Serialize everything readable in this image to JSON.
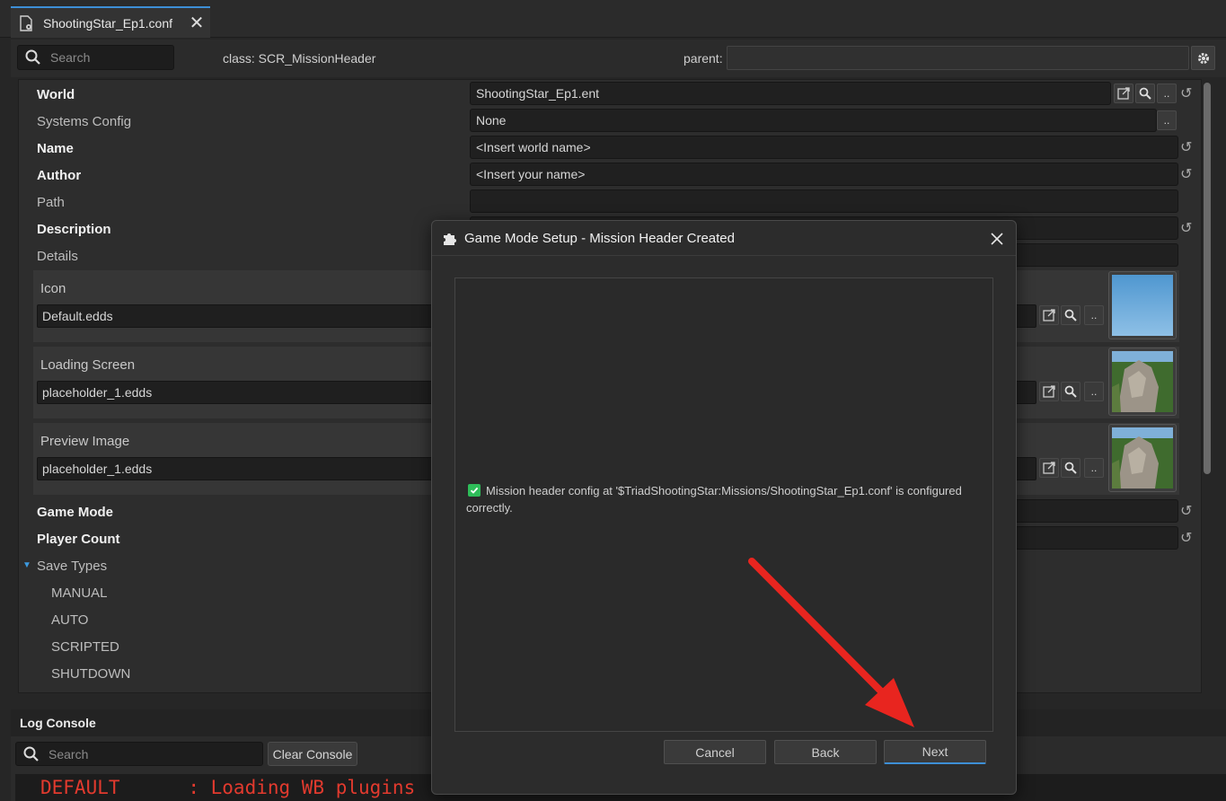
{
  "tab": {
    "title": "ShootingStar_Ep1.conf"
  },
  "header": {
    "search_placeholder": "Search",
    "class_label": "class: SCR_MissionHeader",
    "parent_label": "parent:"
  },
  "properties": {
    "world": {
      "label": "World",
      "value": "ShootingStar_Ep1.ent"
    },
    "systems_config": {
      "label": "Systems Config",
      "value": "None"
    },
    "name": {
      "label": "Name",
      "value": "<Insert world name>"
    },
    "author": {
      "label": "Author",
      "value": "<Insert your name>"
    },
    "path": {
      "label": "Path",
      "value": ""
    },
    "description": {
      "label": "Description"
    },
    "details": {
      "label": "Details"
    },
    "icon": {
      "label": "Icon",
      "value": "Default.edds"
    },
    "loading_screen": {
      "label": "Loading Screen",
      "value": "placeholder_1.edds"
    },
    "preview_image": {
      "label": "Preview Image",
      "value": "placeholder_1.edds"
    },
    "game_mode": {
      "label": "Game Mode"
    },
    "player_count": {
      "label": "Player Count"
    },
    "save_types": {
      "label": "Save Types",
      "items": [
        "MANUAL",
        "AUTO",
        "SCRIPTED",
        "SHUTDOWN"
      ]
    },
    "dots_label": ".."
  },
  "log_console": {
    "title": "Log Console",
    "search_placeholder": "Search",
    "clear_label": "Clear Console",
    "line": "DEFAULT      : Loading WB plugins"
  },
  "dialog": {
    "title": "Game Mode Setup - Mission Header Created",
    "message": "Mission header config at '$TriadShootingStar:Missions/ShootingStar_Ep1.conf' is configured correctly.",
    "cancel_label": "Cancel",
    "back_label": "Back",
    "next_label": "Next"
  },
  "colors": {
    "accent": "#3d8fd6",
    "check": "#2ebd59",
    "arrow": "#e8251f",
    "log_text": "#e23a2e"
  }
}
